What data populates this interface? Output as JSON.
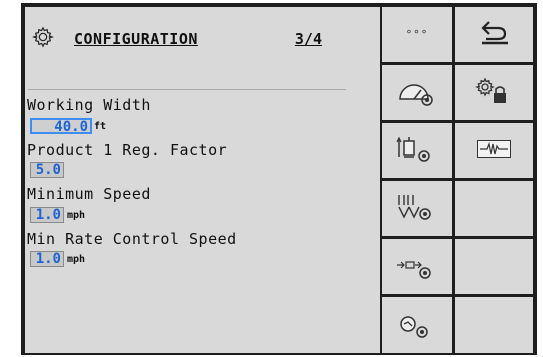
{
  "header": {
    "title": "CONFIGURATION",
    "page": "3/4",
    "icon": "gear-icon"
  },
  "params": [
    {
      "label": "Working Width",
      "value": "40.0",
      "unit": "ft"
    },
    {
      "label": "Product 1 Reg. Factor",
      "value": "5.0",
      "unit": ""
    },
    {
      "label": "Minimum Speed",
      "value": "1.0",
      "unit": "mph"
    },
    {
      "label": "Min Rate Control Speed",
      "value": "1.0",
      "unit": "mph"
    }
  ],
  "softkeys": {
    "more_label": "∘∘∘",
    "col1": [
      "more-icon",
      "gauge-settings-icon",
      "spinner-settings-icon",
      "seed-row-settings-icon",
      "sensor-settings-icon",
      "speed-sensor-settings-icon"
    ],
    "col2": [
      "back-icon",
      "locked-settings-icon",
      "diagnostics-waveform-icon",
      "empty",
      "empty",
      "empty"
    ]
  },
  "colors": {
    "accent": "#1d64d4",
    "selection": "#3d8ef0",
    "panel": "#d9d9d9",
    "frame": "#1e1e1e"
  }
}
